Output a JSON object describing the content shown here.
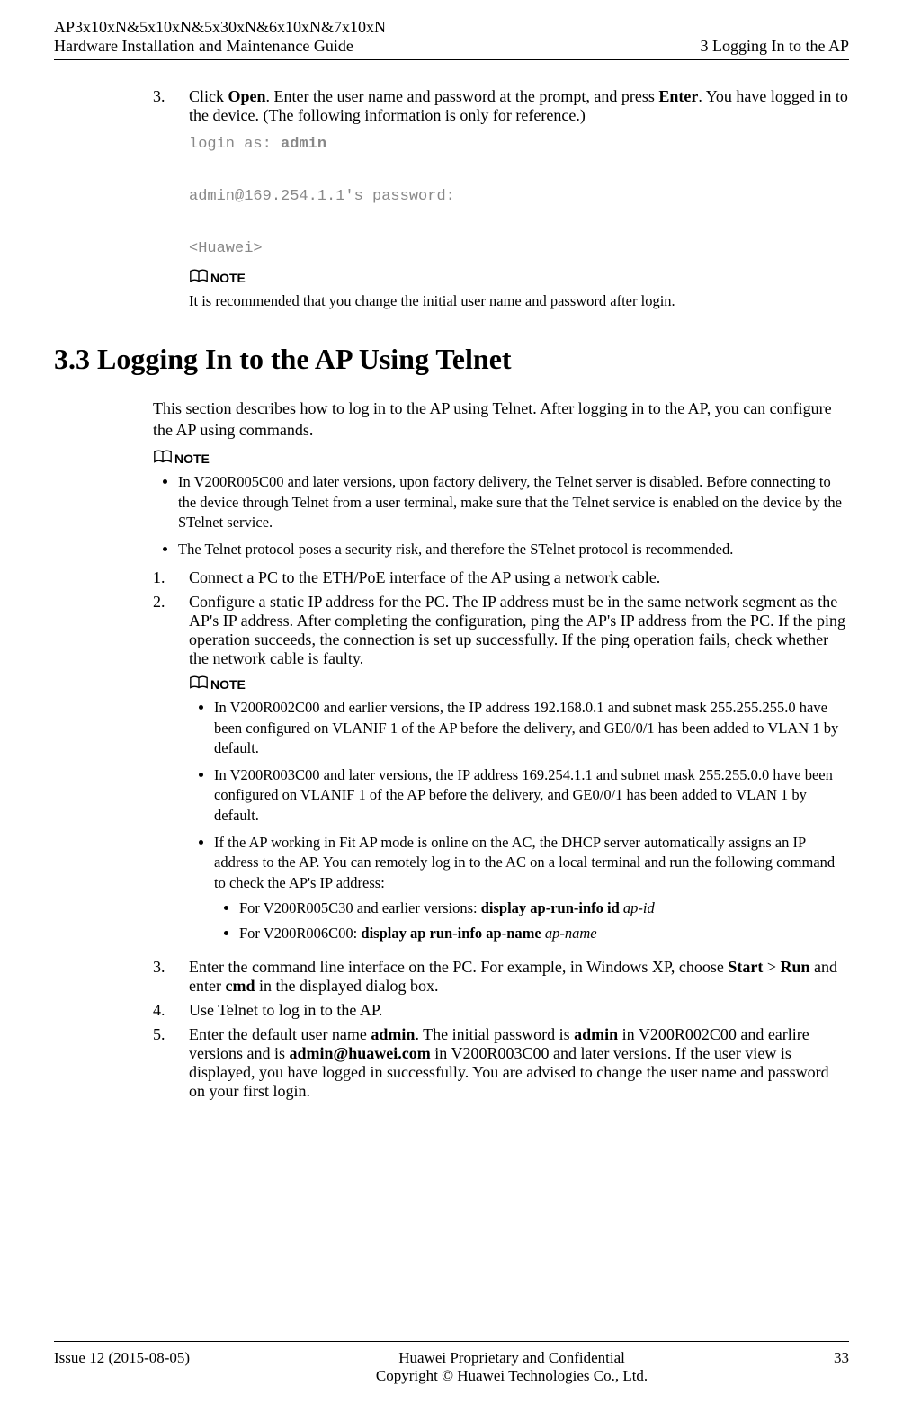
{
  "header": {
    "left_line1": "AP3x10xN&5x10xN&5x30xN&6x10xN&7x10xN",
    "left_line2": "Hardware Installation and Maintenance Guide",
    "right": "3 Logging In to the AP"
  },
  "step3_top": {
    "num": "3.",
    "text_parts": [
      "Click ",
      "Open",
      ". Enter the user name and password at the prompt, and press ",
      "Enter",
      ". You have logged in to the device. (The following information is only for reference.)"
    ],
    "code_line1_prefix": "login as: ",
    "code_line1_bold": "admin",
    "code_line2": "admin@169.254.1.1's password:",
    "code_line3": "<Huawei>",
    "note_label": "NOTE",
    "note_text": "It is recommended that you change the initial user name and password after login."
  },
  "section": {
    "heading": "3.3 Logging In to the AP Using Telnet",
    "intro": "This section describes how to log in to the AP using Telnet. After logging in to the AP, you can configure the AP using commands.",
    "note1_label": "NOTE",
    "note1_bullets": [
      "In V200R005C00 and later versions, upon factory delivery, the Telnet server is disabled. Before connecting to the device through Telnet from a user terminal, make sure that the Telnet service is enabled on the device by the STelnet service.",
      "The Telnet protocol poses a security risk, and therefore the STelnet protocol is recommended."
    ],
    "steps": {
      "s1": {
        "num": "1.",
        "text": "Connect a PC to the ETH/PoE interface of the AP using a network cable."
      },
      "s2": {
        "num": "2.",
        "text": "Configure a static IP address for the PC. The IP address must be in the same network segment as the AP's IP address. After completing the configuration, ping the AP's IP address from the PC. If the ping operation succeeds, the connection is set up successfully. If the ping operation fails, check whether the network cable is faulty."
      },
      "s3": {
        "num": "3."
      },
      "s4": {
        "num": "4.",
        "text": "Use Telnet to log in to the AP."
      },
      "s5": {
        "num": "5."
      }
    },
    "note2_label": "NOTE",
    "note2_bullets": {
      "b1": "In V200R002C00 and earlier versions, the IP address 192.168.0.1 and subnet mask 255.255.255.0 have been configured on VLANIF 1 of the AP before the delivery, and GE0/0/1 has been added to VLAN 1 by default.",
      "b2": "In V200R003C00 and later versions, the IP address 169.254.1.1 and subnet mask 255.255.0.0 have been configured on VLANIF 1 of the AP before the delivery, and GE0/0/1 has been added to VLAN 1 by default.",
      "b3": "If the AP working in Fit AP mode is online on the AC, the DHCP server automatically assigns an IP address to the AP. You can remotely log in to the AC on a local terminal and run the following command to check the AP's IP address:",
      "sub1_prefix": "For V200R005C30 and earlier versions: ",
      "sub1_bold": "display ap-run-info id ",
      "sub1_ital": "ap-id",
      "sub2_prefix": "For V200R006C00: ",
      "sub2_bold": "display ap run-info ap-name ",
      "sub2_ital": "ap-name"
    },
    "s3_parts": [
      "Enter the command line interface on the PC. For example, in Windows XP, choose ",
      "Start",
      " > ",
      "Run",
      " and enter ",
      "cmd",
      " in the displayed dialog box."
    ],
    "s5_parts": [
      "Enter the default user name ",
      "admin",
      ". The initial password is ",
      "admin",
      " in V200R002C00 and earlire versions and is ",
      "admin@huawei.com",
      " in V200R003C00 and later versions. If the user view is displayed, you have logged in successfully. You are advised to change the user name and password on your first login."
    ]
  },
  "footer": {
    "left": "Issue 12 (2015-08-05)",
    "center_line1": "Huawei Proprietary and Confidential",
    "center_line2": "Copyright © Huawei Technologies Co., Ltd.",
    "right": "33"
  }
}
